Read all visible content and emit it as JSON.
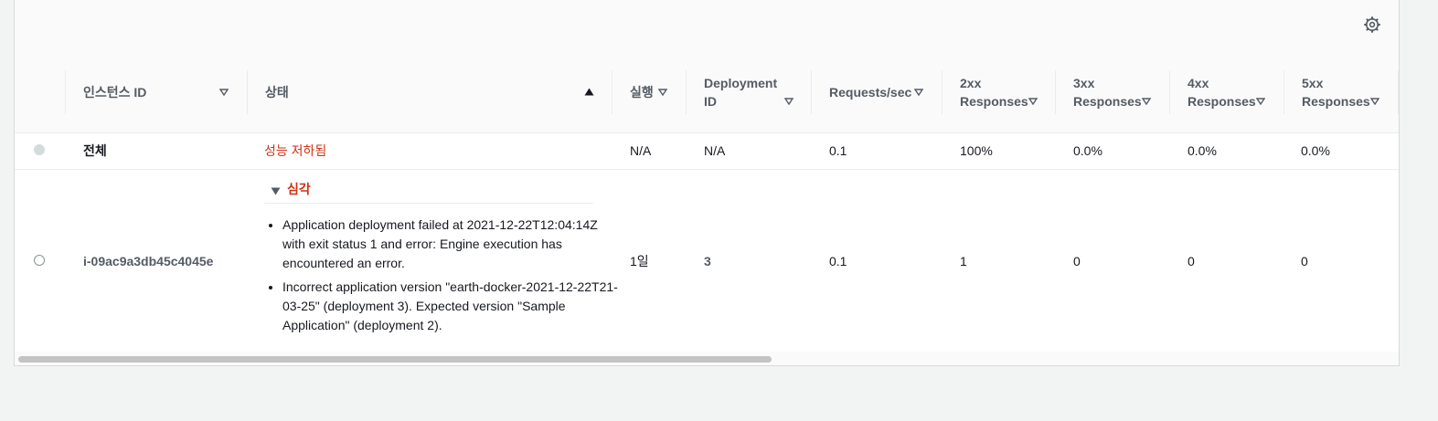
{
  "table": {
    "columns": [
      {
        "label": "인스턴스 ID",
        "sort": "none"
      },
      {
        "label": "상태",
        "sort": "ascending"
      },
      {
        "label": "실행",
        "sort": "none"
      },
      {
        "label": "Deployment ID",
        "line1": "Deployment",
        "line2": "ID",
        "sort": "none"
      },
      {
        "label": "Requests/sec",
        "sort": "none"
      },
      {
        "label": "2xx Responses",
        "line1": "2xx",
        "line2": "Responses",
        "sort": "none"
      },
      {
        "label": "3xx Responses",
        "line1": "3xx",
        "line2": "Responses",
        "sort": "none"
      },
      {
        "label": "4xx Responses",
        "line1": "4xx",
        "line2": "Responses",
        "sort": "none"
      },
      {
        "label": "5xx Responses",
        "line1": "5xx",
        "line2": "Responses",
        "sort": "none"
      }
    ],
    "rows": [
      {
        "instance_id": "전체",
        "status": "성능 저하됨",
        "running": "N/A",
        "deployment_id": "N/A",
        "requests_per_sec": "0.1",
        "r2xx": "100%",
        "r3xx": "0.0%",
        "r4xx": "0.0%",
        "r5xx": "0.0%"
      },
      {
        "instance_id": "i-09ac9a3db45c4045e",
        "status_section_title": "심각",
        "causes": [
          "Application deployment failed at 2021-12-22T12:04:14Z with exit status 1 and error: Engine execution has encountered an error.",
          "Incorrect application version \"earth-docker-2021-12-22T21-03-25\" (deployment 3). Expected version \"Sample Application\" (deployment 2)."
        ],
        "running": "1일",
        "deployment_id": "3",
        "requests_per_sec": "0.1",
        "r2xx": "1",
        "r3xx": "0",
        "r4xx": "0",
        "r5xx": "0"
      }
    ]
  },
  "icons": {
    "settings": "gear-icon",
    "sort": "caret-down-icon",
    "sort_active": "caret-up-icon"
  },
  "colors": {
    "status_error": "#d13212",
    "header_bg": "#fafafa",
    "text": "#16191f"
  }
}
